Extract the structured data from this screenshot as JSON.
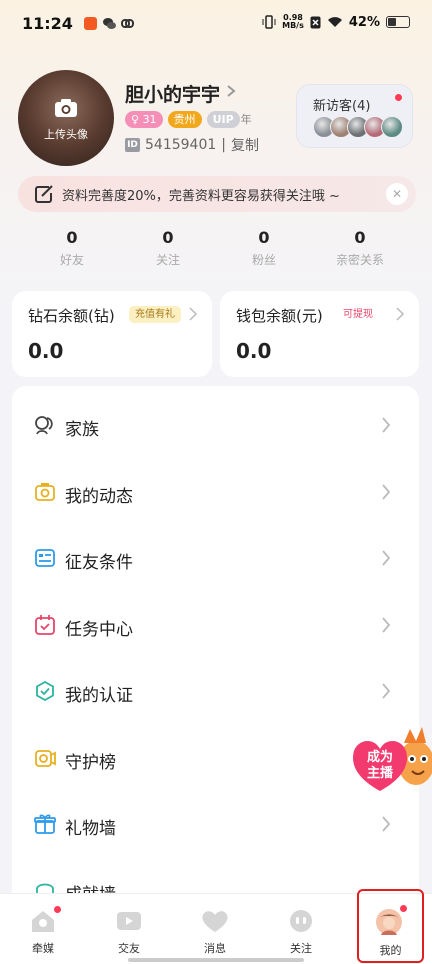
{
  "status_bar": {
    "time": "11:24",
    "net_speed_value": "0.98",
    "net_speed_unit": "MB/s",
    "battery": "42%"
  },
  "profile": {
    "upload_avatar_label": "上传头像",
    "nickname": "胆小的宇宇",
    "tags": {
      "age": "31",
      "location": "贵州",
      "vip": "UIP",
      "vip_suffix": "年"
    },
    "id_icon_text": "ID",
    "user_id": "54159401",
    "id_separator": "|",
    "copy_label": "复制"
  },
  "visitors": {
    "title": "新访客(4)",
    "avatar_colors": [
      "#8a8f95",
      "#9f8172",
      "#6c6f73",
      "#b46a75",
      "#5c8b83"
    ]
  },
  "completion_banner": {
    "text": "资料完善度20%，完善资料更容易获得关注哦 ~",
    "close_glyph": "✕"
  },
  "stats": [
    {
      "value": "0",
      "label": "好友"
    },
    {
      "value": "0",
      "label": "关注"
    },
    {
      "value": "0",
      "label": "粉丝"
    },
    {
      "value": "0",
      "label": "亲密关系"
    }
  ],
  "balances": {
    "diamond": {
      "title": "钻石余额(钻)",
      "badge": "充值有礼",
      "amount": "0.0"
    },
    "wallet": {
      "title": "钱包余额(元)",
      "badge": "可提现",
      "amount": "0.0"
    }
  },
  "menu": [
    {
      "label": "家族",
      "icon": "family-icon",
      "color": "#444444"
    },
    {
      "label": "我的动态",
      "icon": "camera-icon",
      "color": "#e8b021"
    },
    {
      "label": "征友条件",
      "icon": "profile-card-icon",
      "color": "#2f9be8"
    },
    {
      "label": "任务中心",
      "icon": "calendar-icon",
      "color": "#e8466a"
    },
    {
      "label": "我的认证",
      "icon": "shield-check-icon",
      "color": "#2bb4a0"
    },
    {
      "label": "守护榜",
      "icon": "guard-icon",
      "color": "#e8b021"
    },
    {
      "label": "礼物墙",
      "icon": "gift-icon",
      "color": "#2f9be8"
    },
    {
      "label": "成就墙",
      "icon": "achievement-icon",
      "color": "#2bb4a0"
    }
  ],
  "promo": {
    "text_line1": "成为",
    "text_line2": "主播"
  },
  "tabbar": [
    {
      "label": "牵媒",
      "icon": "home-icon",
      "dot": true
    },
    {
      "label": "交友",
      "icon": "video-icon",
      "dot": false
    },
    {
      "label": "消息",
      "icon": "heart-message-icon",
      "dot": false
    },
    {
      "label": "关注",
      "icon": "face-icon",
      "dot": false
    },
    {
      "label": "我的",
      "icon": "me-avatar-icon",
      "dot": true
    }
  ]
}
